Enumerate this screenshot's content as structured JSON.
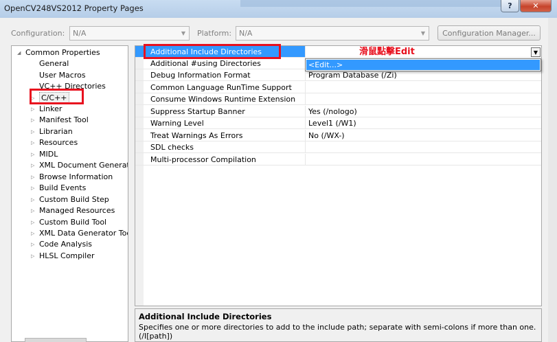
{
  "window": {
    "title": "OpenCV248VS2012 Property Pages",
    "help_label": "?",
    "close_label": "✕"
  },
  "config_bar": {
    "configuration_label": "Configuration:",
    "configuration_value": "N/A",
    "platform_label": "Platform:",
    "platform_value": "N/A",
    "config_manager_label": "Configuration Manager..."
  },
  "tree": {
    "root_label": "Common Properties",
    "items": [
      {
        "label": "General"
      },
      {
        "label": "User Macros"
      },
      {
        "label": "VC++ Directories"
      },
      {
        "label": "C/C++"
      },
      {
        "label": "Linker"
      },
      {
        "label": "Manifest Tool"
      },
      {
        "label": "Librarian"
      },
      {
        "label": "Resources"
      },
      {
        "label": "MIDL"
      },
      {
        "label": "XML Document Generato"
      },
      {
        "label": "Browse Information"
      },
      {
        "label": "Build Events"
      },
      {
        "label": "Custom Build Step"
      },
      {
        "label": "Managed Resources"
      },
      {
        "label": "Custom Build Tool"
      },
      {
        "label": "XML Data Generator Too"
      },
      {
        "label": "Code Analysis"
      },
      {
        "label": "HLSL Compiler"
      }
    ]
  },
  "properties": [
    {
      "name": "Additional Include Directories",
      "value": ""
    },
    {
      "name": "Additional #using Directories",
      "value": ""
    },
    {
      "name": "Debug Information Format",
      "value": "Program Database (/Zi)"
    },
    {
      "name": "Common Language RunTime Support",
      "value": ""
    },
    {
      "name": "Consume Windows Runtime Extension",
      "value": ""
    },
    {
      "name": "Suppress Startup Banner",
      "value": "Yes (/nologo)"
    },
    {
      "name": "Warning Level",
      "value": "Level1 (/W1)"
    },
    {
      "name": "Treat Warnings As Errors",
      "value": "No (/WX-)"
    },
    {
      "name": "SDL checks",
      "value": ""
    },
    {
      "name": "Multi-processor Compilation",
      "value": ""
    }
  ],
  "dropdown": {
    "option": "<Edit...>"
  },
  "annotation": {
    "text": "滑鼠點擊Edit",
    "color": "#e8101e"
  },
  "description": {
    "title": "Additional Include Directories",
    "text": "Specifies one or more directories to add to the include path; separate with semi-colons if more than one.",
    "text2": "(/I[path])"
  },
  "colors": {
    "selection": "#3399ff",
    "annotation_red": "#e8101e"
  }
}
